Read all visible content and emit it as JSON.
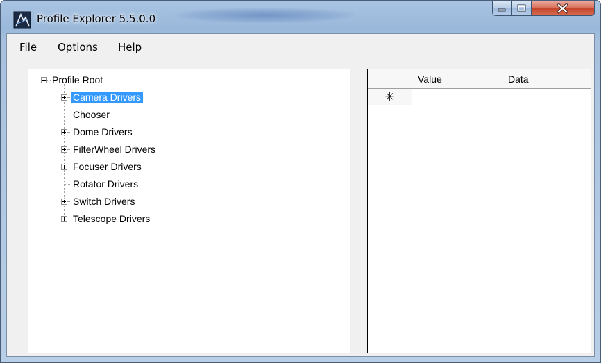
{
  "window": {
    "title": "Profile Explorer 5.5.0.0",
    "icon": "ascom-logo-icon",
    "caption_buttons": [
      "minimize-icon",
      "maximize-icon",
      "close-icon"
    ],
    "accent_color": "#3399ff"
  },
  "menu": {
    "items": [
      "File",
      "Options",
      "Help"
    ]
  },
  "tree": {
    "root_label": "Profile Root",
    "children": [
      {
        "label": "Camera Drivers",
        "expandable": true,
        "selected": true
      },
      {
        "label": "Chooser",
        "expandable": false,
        "selected": false
      },
      {
        "label": "Dome Drivers",
        "expandable": true,
        "selected": false
      },
      {
        "label": "FilterWheel Drivers",
        "expandable": true,
        "selected": false
      },
      {
        "label": "Focuser Drivers",
        "expandable": true,
        "selected": false
      },
      {
        "label": "Rotator Drivers",
        "expandable": false,
        "selected": false
      },
      {
        "label": "Switch Drivers",
        "expandable": true,
        "selected": false
      },
      {
        "label": "Telescope Drivers",
        "expandable": true,
        "selected": false
      }
    ]
  },
  "grid": {
    "columns": [
      "Value",
      "Data"
    ],
    "new_row_marker": "✳"
  }
}
